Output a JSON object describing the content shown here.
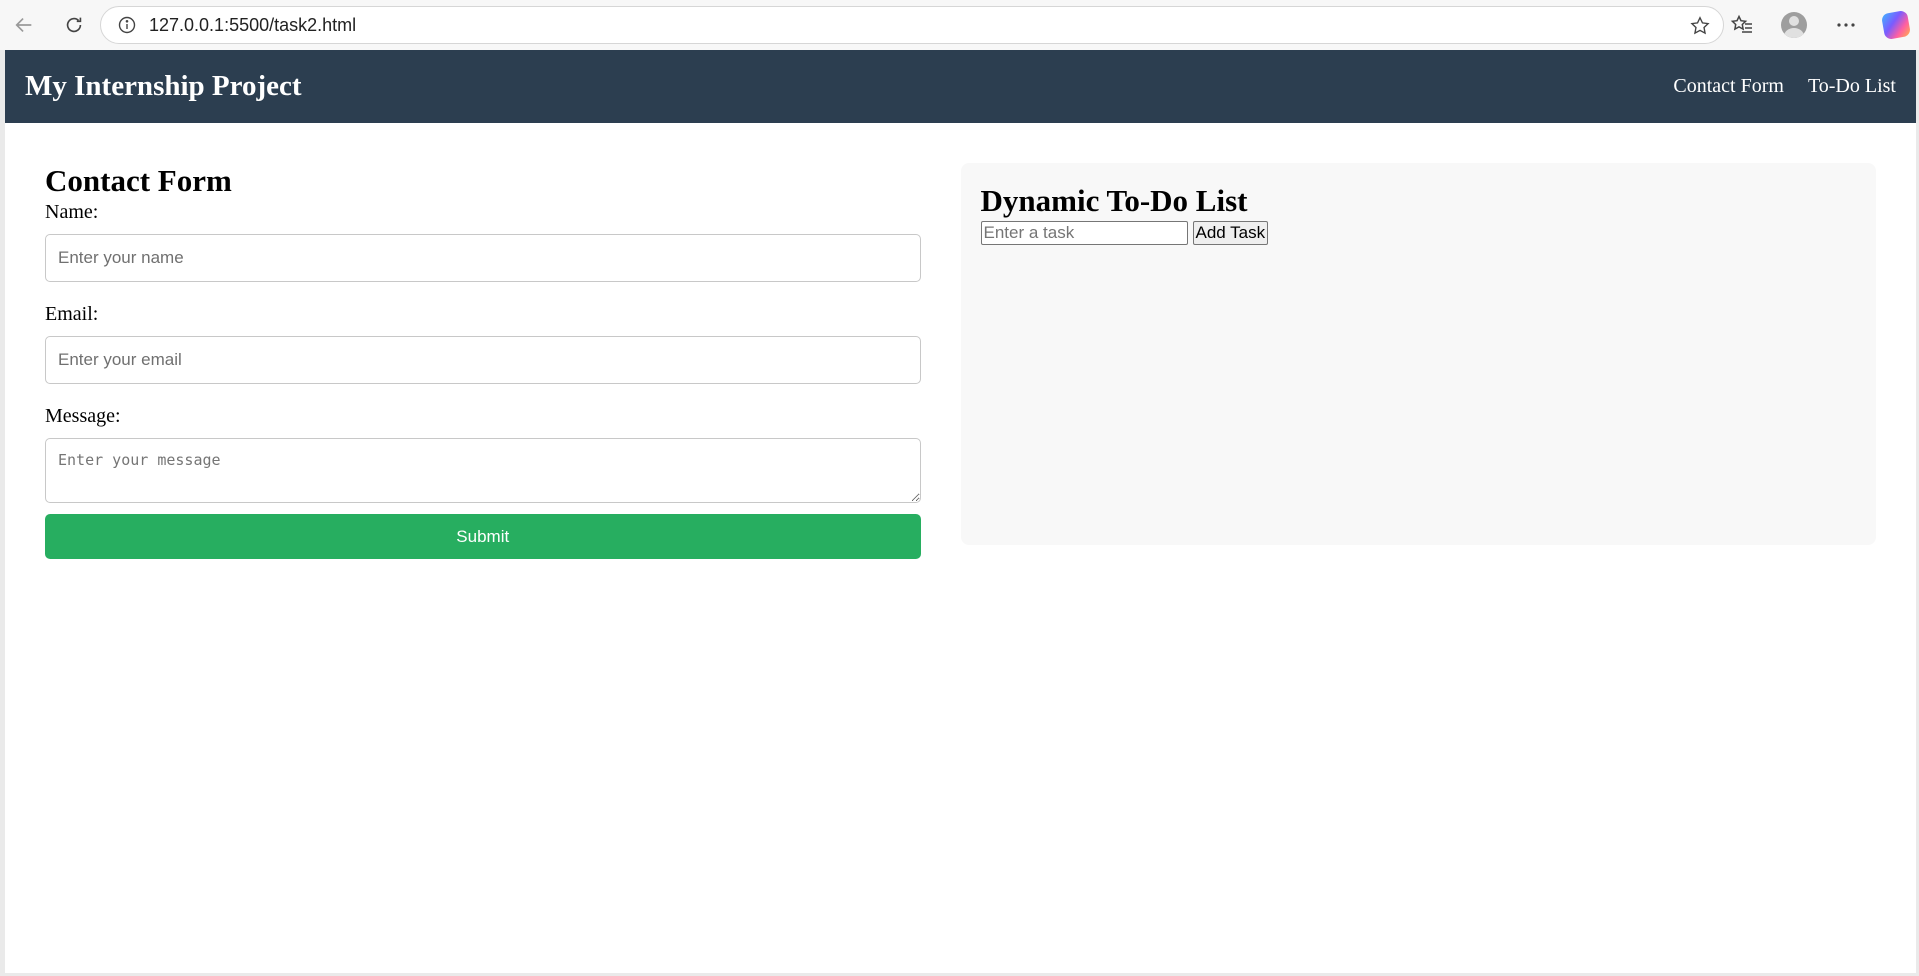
{
  "browser": {
    "url": "127.0.0.1:5500/task2.html",
    "icons": {
      "back": "back-arrow-icon",
      "reload": "reload-icon",
      "info": "info-icon",
      "star": "star-icon",
      "favorites": "favorites-icon",
      "profile": "profile-icon",
      "more": "more-icon",
      "copilot": "copilot-icon"
    }
  },
  "header": {
    "title": "My Internship Project",
    "nav": [
      "Contact Form",
      "To-Do List"
    ]
  },
  "contact": {
    "title": "Contact Form",
    "name_label": "Name:",
    "name_placeholder": "Enter your name",
    "email_label": "Email:",
    "email_placeholder": "Enter your email",
    "message_label": "Message:",
    "message_placeholder": "Enter your message",
    "submit_label": "Submit"
  },
  "todo": {
    "title": "Dynamic To-Do List",
    "task_placeholder": "Enter a task",
    "add_label": "Add Task"
  },
  "colors": {
    "header_bg": "#2c3e50",
    "submit_bg": "#27ae60",
    "todo_bg": "#f8f8f8"
  }
}
